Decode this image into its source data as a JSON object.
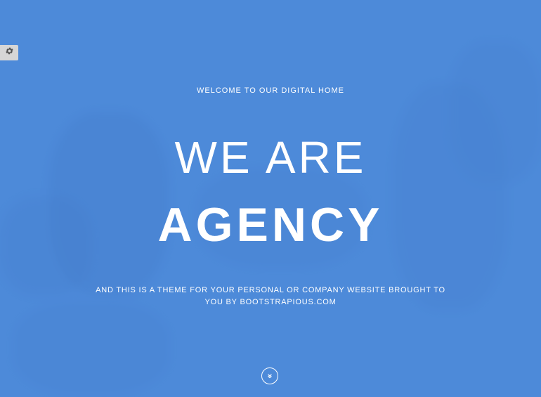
{
  "hero": {
    "kicker": "WELCOME TO OUR DIGITAL HOME",
    "heading_line1": "WE ARE",
    "heading_line2": "AGENCY",
    "tagline": "AND THIS IS A THEME FOR YOUR PERSONAL OR COMPANY WEBSITE BROUGHT TO YOU BY BOOTSTRAPIOUS.COM"
  },
  "icons": {
    "settings": "gear-icon",
    "scroll_down": "chevron-down-icon"
  },
  "colors": {
    "background": "#4d8ad9",
    "text": "#ffffff",
    "settings_tab": "#d6d6d6"
  }
}
